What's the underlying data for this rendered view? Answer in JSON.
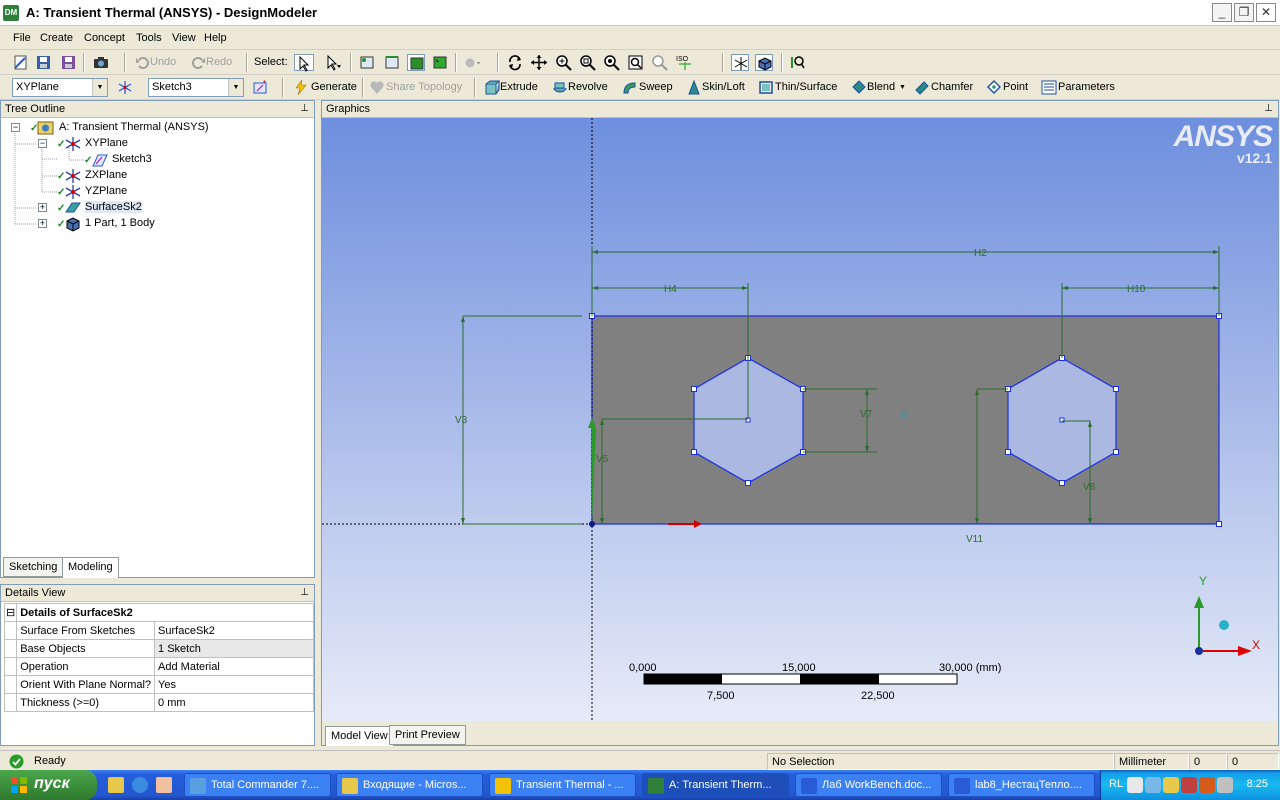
{
  "window": {
    "icon_text": "DM",
    "title": "A: Transient Thermal (ANSYS) - DesignModeler",
    "minimize": "_",
    "maximize": "❐",
    "close": "✕"
  },
  "menu": [
    "File",
    "Create",
    "Concept",
    "Tools",
    "View",
    "Help"
  ],
  "toolbar1": {
    "undo": "Undo",
    "redo": "Redo",
    "select": "Select:"
  },
  "toolbar2": {
    "plane": "XYPlane",
    "sketch": "Sketch3",
    "generate": "Generate",
    "share_topology": "Share Topology",
    "extrude": "Extrude",
    "revolve": "Revolve",
    "sweep": "Sweep",
    "skin_loft": "Skin/Loft",
    "thin_surface": "Thin/Surface",
    "blend": "Blend",
    "chamfer": "Chamfer",
    "point": "Point",
    "parameters": "Parameters"
  },
  "tree": {
    "header": "Tree Outline",
    "items": [
      {
        "label": "A: Transient Thermal (ANSYS)"
      },
      {
        "label": "XYPlane"
      },
      {
        "label": "Sketch3"
      },
      {
        "label": "ZXPlane"
      },
      {
        "label": "YZPlane"
      },
      {
        "label": "SurfaceSk2"
      },
      {
        "label": "1 Part, 1 Body"
      }
    ]
  },
  "tabs": {
    "sketching": "Sketching",
    "modeling": "Modeling"
  },
  "details": {
    "header": "Details View",
    "title": "Details of SurfaceSk2",
    "rows": [
      {
        "k": "Surface From Sketches",
        "v": "SurfaceSk2"
      },
      {
        "k": "Base Objects",
        "v": "1 Sketch"
      },
      {
        "k": "Operation",
        "v": "Add Material"
      },
      {
        "k": "Orient With Plane Normal?",
        "v": "Yes"
      },
      {
        "k": "Thickness (>=0)",
        "v": "0 mm"
      }
    ]
  },
  "graphics": {
    "header": "Graphics",
    "logo": "ANSYS",
    "version": "v12.1",
    "dims": {
      "h2": "H2",
      "h4": "H4",
      "h10": "H10",
      "v3": "V3",
      "v5": "V5",
      "v7": "V7",
      "v8": "V8",
      "v11": "V11"
    },
    "axes": {
      "x": "X",
      "y": "Y"
    },
    "scale": {
      "t0": "0,000",
      "t1": "15,000",
      "t2": "30,000 (mm)",
      "b1": "7,500",
      "b2": "22,500"
    },
    "tabs": {
      "model_view": "Model View",
      "print_preview": "Print Preview"
    }
  },
  "status": {
    "ready": "Ready",
    "selection": "No Selection",
    "units": "Millimeter",
    "v1": "0",
    "v2": "0"
  },
  "taskbar": {
    "start": "пуск",
    "buttons": [
      {
        "label": "Total Commander 7...."
      },
      {
        "label": "Входящие - Micros..."
      },
      {
        "label": "Transient Thermal - ..."
      },
      {
        "label": "A: Transient Therm..."
      },
      {
        "label": "Лаб WorkBench.doc..."
      },
      {
        "label": "lab8_НестацТепло...."
      }
    ],
    "lang": "RL",
    "clock": "8:25"
  }
}
